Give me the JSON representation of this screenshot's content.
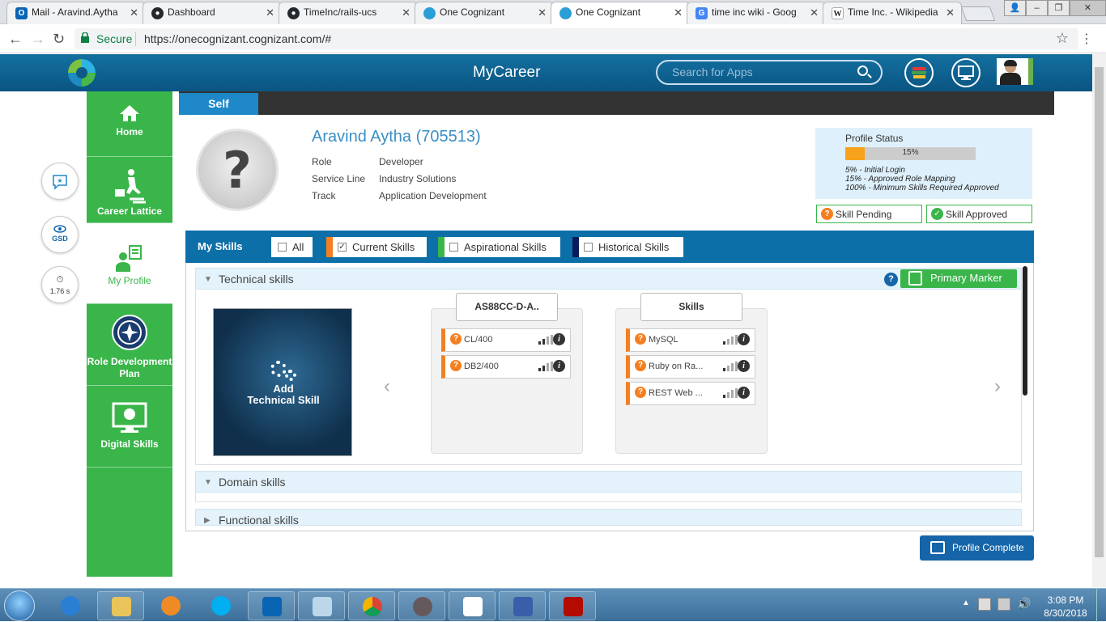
{
  "browser": {
    "tabs": [
      {
        "label": "Mail - Aravind.Aytha",
        "icon": "outlook-icon",
        "color": "#0a64b4"
      },
      {
        "label": "Dashboard",
        "icon": "github-icon",
        "color": "#24292e"
      },
      {
        "label": "TimeInc/rails-ucs",
        "icon": "github-icon",
        "color": "#24292e"
      },
      {
        "label": "One Cognizant",
        "icon": "cognizant-icon",
        "color": "#2a9fd6"
      },
      {
        "label": "One Cognizant",
        "icon": "cognizant-icon",
        "color": "#2a9fd6"
      },
      {
        "label": "time inc wiki - Goog",
        "icon": "google-icon",
        "color": "#4285f4"
      },
      {
        "label": "Time Inc. - Wikipedia",
        "icon": "wikipedia-icon",
        "color": "#555555"
      }
    ],
    "secure_label": "Secure",
    "url": "https://onecognizant.cognizant.com/#"
  },
  "header": {
    "title": "MyCareer",
    "search_placeholder": "Search for Apps"
  },
  "floating": {
    "gsd_label": "GSD",
    "timer_value": "1.76 s"
  },
  "sidebar": {
    "items": [
      {
        "label": "Home"
      },
      {
        "label": "Career Lattice"
      },
      {
        "label": "My Profile"
      },
      {
        "label": "Role Development Plan"
      },
      {
        "label": "Digital Skills"
      }
    ]
  },
  "tabs": {
    "self": "Self"
  },
  "profile": {
    "name": "Aravind Aytha (705513)",
    "role_label": "Role",
    "role": "Developer",
    "service_line_label": "Service Line",
    "service_line": "Industry Solutions",
    "track_label": "Track",
    "track": "Application Development"
  },
  "status": {
    "title": "Profile Status",
    "percent": 15,
    "percent_text": "15%",
    "legend": [
      "5% - Initial Login",
      "15% - Approved Role Mapping",
      "100% - Minimum Skills Required Approved"
    ],
    "pending_label": "Skill Pending",
    "approved_label": "Skill Approved"
  },
  "skills": {
    "title": "My Skills",
    "filters": [
      {
        "label": "All",
        "checked": false,
        "color": ""
      },
      {
        "label": "Current Skills",
        "checked": true,
        "color": "#f57f20"
      },
      {
        "label": "Aspirational Skills",
        "checked": false,
        "color": "#3ab54a"
      },
      {
        "label": "Historical Skills",
        "checked": false,
        "color": "#0a1a5c"
      }
    ],
    "sections": {
      "technical": "Technical skills",
      "domain": "Domain skills",
      "functional": "Functional skills"
    },
    "primary_marker": "Primary Marker",
    "add_label_1": "Add",
    "add_label_2": "Technical Skill",
    "groups": [
      {
        "title": "AS88CC-D-A..",
        "items": [
          "CL/400",
          "DB2/400"
        ]
      },
      {
        "title": "Skills",
        "items": [
          "MySQL",
          "Ruby on Ra...",
          "REST Web ..."
        ]
      }
    ],
    "prev_arrow": "‹",
    "next_arrow": "›"
  },
  "profile_complete": "Profile Complete",
  "taskbar": {
    "time": "3:08 PM",
    "date": "8/30/2018"
  }
}
